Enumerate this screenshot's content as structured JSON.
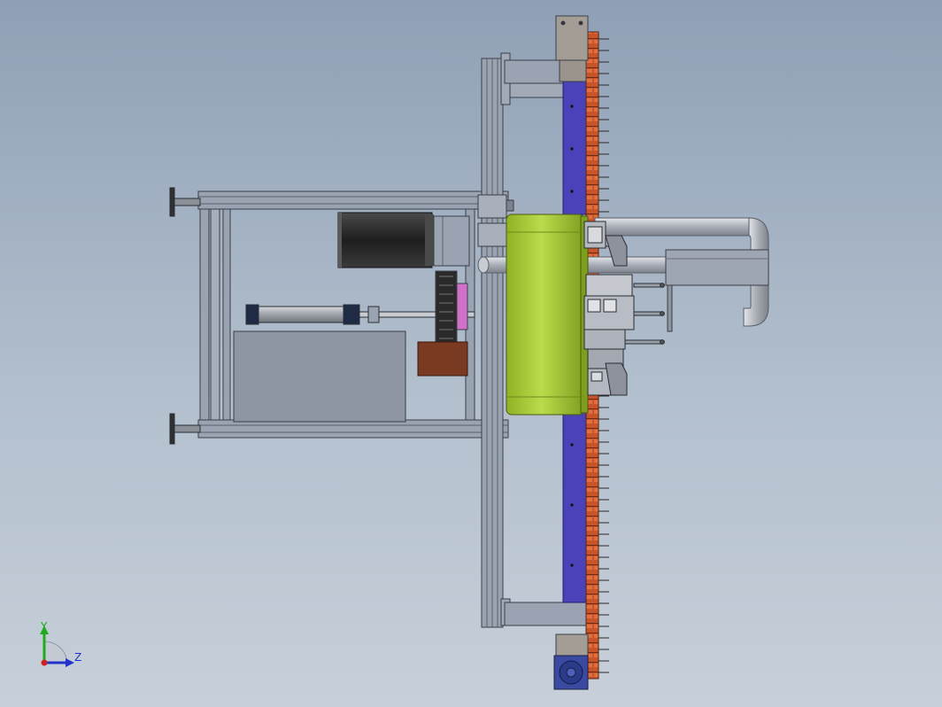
{
  "triad": {
    "y_label": "Y",
    "z_label": "Z",
    "y_color": "#1faa1f",
    "z_color": "#2233cc",
    "origin_color": "#cc2222"
  },
  "colors": {
    "background_top": "#8fa0b6",
    "background_bottom": "#c7d0da",
    "frame_steel": "#9aa3b2",
    "frame_edge": "#3a3e46",
    "drum_green": "#a4cc3a",
    "rail_blue": "#4a42b8",
    "chain_orange": "#c8552a",
    "motor_black": "#2a2a2a",
    "pink_pulley": "#d070c8",
    "brown_block": "#7a3a22",
    "pipe_gray": "#b4b8c0"
  }
}
